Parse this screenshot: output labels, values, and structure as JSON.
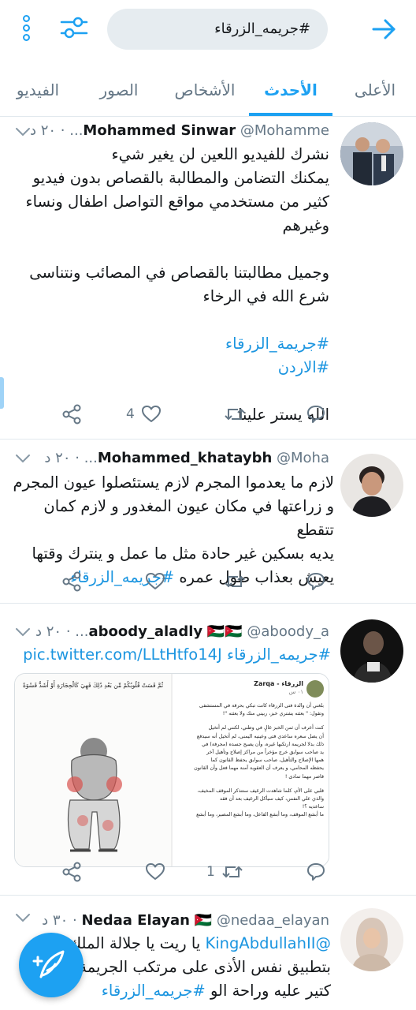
{
  "search": {
    "query": "#جريمه_الزرقاء"
  },
  "tabs": [
    {
      "label": "الأعلى"
    },
    {
      "label": "الأحدث"
    },
    {
      "label": "الأشخاص"
    },
    {
      "label": "الصور"
    },
    {
      "label": "الفيديو"
    }
  ],
  "active_tab": "الأحدث",
  "colors": {
    "accent": "#1da1f2",
    "text": "#14171a",
    "muted": "#657786",
    "link": "#1b95e0"
  },
  "tweets": [
    {
      "name": "Mohammed Sinwar",
      "handle": "@Mohamme...",
      "time": "٢٠ د",
      "lines": [
        "نشرك للفيديو اللعين لن يغير شيء",
        "يمكنك التضامن والمطالبة بالقصاص بدون فيديو",
        "كثير من مستخدمي مواقع التواصل اطفال ونساء",
        "وغيرهم",
        "وجميل مطالبتنا بالقصاص في المصائب ونتناسى",
        "شرع الله في الرخاء"
      ],
      "hashtags": [
        "#جريمة_الزرقاء",
        "#الاردن"
      ],
      "closing": "الله يستر علينا",
      "likes": "4",
      "retweets": ""
    },
    {
      "name": "Mohammed_khataybh",
      "handle": "@Moha...",
      "time": "٢٠ د",
      "lines": [
        "لازم ما يعدموا المجرم لازم يستئصلوا عيون المجرم",
        "و زراعتها في مكان عيون المغدور و لازم كمان تتقطع",
        "يديه بسكين غير حادة مثل ما عمل و ينترك وقتها"
      ],
      "last_line_text": "يعيش بعذاب طول عمره",
      "last_line_hashtag": "#جريمه_الزرقاء",
      "likes": "",
      "retweets": ""
    },
    {
      "name": "aboody_aladly",
      "flags": "🇯🇴🇯🇴",
      "handle": "@aboody_a...",
      "time": "٢٠ د",
      "hashtag": "#جريمه_الزرقاء",
      "link": "pic.twitter.com/LLtHtfo14J",
      "media": {
        "page_title": "الزرقاء - Zarqa",
        "page_time": "٠١ س",
        "left_quote": "ثُمَّ قَسَتْ قُلُوبُكُمْ مِّن بَعْدِ ذَٰلِكَ فَهِيَ كَالْحِجَارَةِ أَوْ أَشَدُّ قَسْوَةً",
        "post_lines": [
          "بلغني أن والدة فتى الزرقاء كانت تبكي بحرقة في المستشفى",
          "وتقول: \" بعثته يشتري خبز، ربيني منك ولا بعثته \"!",
          "كنت أعرف أن ثمن الخبز غالٍ في وطني، لكنني لم أتخيل",
          "أن يصل سعره ساعدي فتى وعينيه اليمنى، لم أتخيل أنه سيدفع",
          "ذلك بدلا لجريمة ارتكبها غيره، وأن يصبح جسده (مجرفة) في",
          "يد صاحب سوابق خرج مؤخراً من مراكز إصلاح وتأهيل آخر",
          "همها الإصلاح والتأهيل، صاحب سوابق يحفظ القانون كما",
          "يحفظه المحامي، و يعرف أن العقوبة آمنة مهما فعل وأن القانون",
          "قاصر مهما تمادى !",
          "قلبي على الأم، كلما شاهدت الرغيف ستتذكر الموقف المخيف،",
          "والذي علي النفس، كيف سيأكل الرغيف بعد أن فقد",
          "ساعديه ؟!",
          "ما أبشع الموقف، وما أبشع الفاعل، وما أبشع المصير، وما أبشع"
        ]
      },
      "likes": "",
      "retweets": "1"
    },
    {
      "name": "Nedaa Elayan",
      "flags": "🇯🇴",
      "handle": "@nedaa_elayan",
      "time": "٣٠ د",
      "mention": "@KingAbdullahII",
      "line1_text": "يا ريت يا جلالة الملك",
      "line2": "بتطبيق نفس الأذى على مرتكب الجريمة",
      "line3_text": "كتير عليه وراحة الو",
      "line3_hashtag": "#جريمه_الزرقاء"
    }
  ]
}
